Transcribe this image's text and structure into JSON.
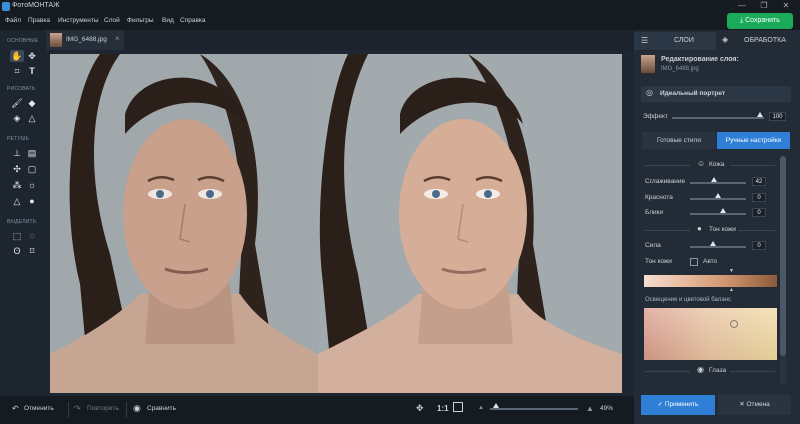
{
  "app": {
    "title": "ФотоМОНТАЖ"
  },
  "window_controls": {
    "minimize": "—",
    "maximize": "❐",
    "close": "✕"
  },
  "menu": [
    "Файл",
    "Правка",
    "Инструменты",
    "Слой",
    "Фильтры",
    "Вид",
    "Справка"
  ],
  "save_label": "Сохранить",
  "toolbar": {
    "sections": {
      "basic": "ОСНОВНЫЕ",
      "draw": "РИСОВАТЬ",
      "retouch": "РЕТУШЬ",
      "select": "ВЫДЕЛИТЬ"
    }
  },
  "file_tab": {
    "name": "IMG_6488.jpg",
    "close": "×"
  },
  "bottom": {
    "undo": "Отменить",
    "redo": "Повторить",
    "compare": "Сравнить",
    "ratio": "1:1",
    "zoom": "49%"
  },
  "panel": {
    "tabs": {
      "layers": "СЛОИ",
      "processing": "ОБРАБОТКА"
    },
    "layer_title": "Редактирование слоя:",
    "layer_file": "IMG_6488.jpg",
    "preset": "Идеальный портрет",
    "effect": {
      "label": "Эффект",
      "value": "100",
      "level": 1.0
    },
    "mode_tabs": {
      "ready": "Готовые стили",
      "manual": "Ручные настройки"
    },
    "skin_section": "Кожа",
    "sliders": [
      {
        "label": "Сглаживание",
        "value": "42",
        "level": 0.42
      },
      {
        "label": "Краснота",
        "value": "0",
        "level": 0.5
      },
      {
        "label": "Блики",
        "value": "0",
        "level": 0.6
      }
    ],
    "tone_section": "Тон кожи",
    "strength": {
      "label": "Сила",
      "value": "0",
      "level": 0.4
    },
    "skin_tone": {
      "label": "Тон кожи",
      "auto": "Авто"
    },
    "lighting_label": "Освещение и цветовой баланс",
    "eyes_section": "Глаза",
    "apply": "Применить",
    "cancel": "Отмена"
  },
  "colors": {
    "accent": "#2f7fd6",
    "save_green": "#1aaa5a",
    "bg": "#1c232d"
  }
}
